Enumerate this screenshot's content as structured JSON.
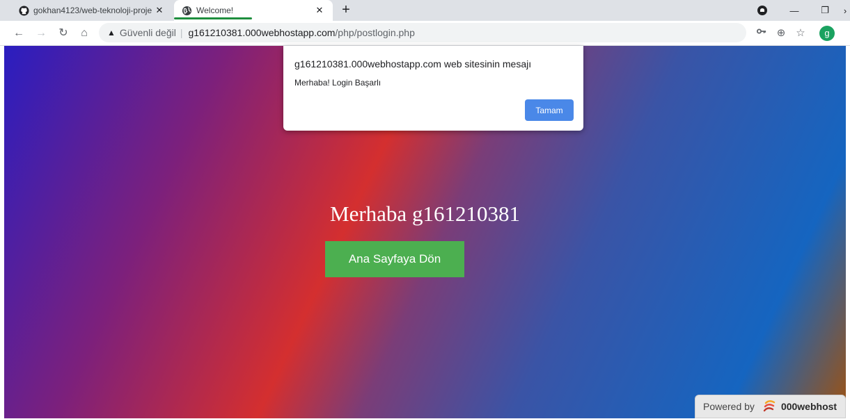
{
  "tabs": [
    {
      "label": "gokhan4123/web-teknoloji-proje",
      "icon": "github-icon",
      "active": false
    },
    {
      "label": "Welcome!",
      "icon": "globe-icon",
      "active": true
    }
  ],
  "toolbar": {
    "security_label": "Güvenli değil",
    "url_host": "g161210381.000webhostapp.com",
    "url_path": "/php/postlogin.php",
    "avatar_letter": "g"
  },
  "alert": {
    "title": "g161210381.000webhostapp.com web sitesinin mesajı",
    "message": "Merhaba! Login Başarlı",
    "ok_label": "Tamam"
  },
  "page": {
    "greeting": "Merhaba g161210381",
    "home_button_label": "Ana Sayfaya Dön",
    "powered_prefix": "Powered by",
    "powered_brand": "000webhost"
  },
  "colors": {
    "button_green": "#4caf50",
    "alert_button_blue": "#4a88e8",
    "avatar_green": "#1aa260"
  }
}
